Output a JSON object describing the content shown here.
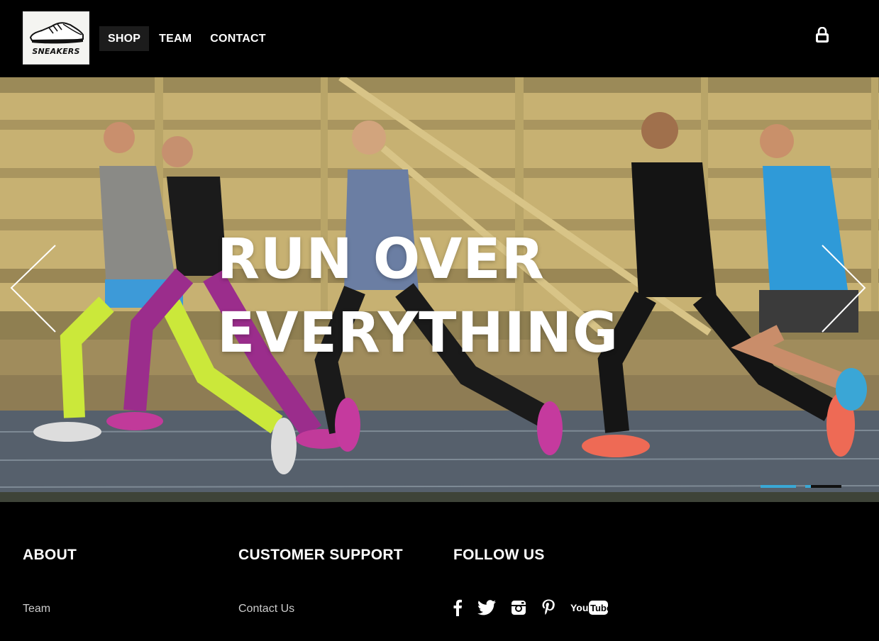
{
  "header": {
    "logo_text": "SNEAKERS",
    "nav": [
      {
        "label": "SHOP",
        "active": true
      },
      {
        "label": "TEAM",
        "active": false
      },
      {
        "label": "CONTACT",
        "active": false
      }
    ],
    "cart_icon": "shopping-bag-icon"
  },
  "hero": {
    "title_line1": "RUN OVER",
    "title_line2": "EVERYTHING",
    "slides": 2,
    "active_slide": 0,
    "accent_color": "#3aa8d6"
  },
  "footer": {
    "about": {
      "heading": "ABOUT",
      "link": "Team"
    },
    "support": {
      "heading": "CUSTOMER SUPPORT",
      "link": "Contact Us"
    },
    "follow": {
      "heading": "FOLLOW US",
      "icons": [
        "facebook-icon",
        "twitter-icon",
        "instagram-icon",
        "pinterest-icon",
        "youtube-icon"
      ]
    }
  }
}
